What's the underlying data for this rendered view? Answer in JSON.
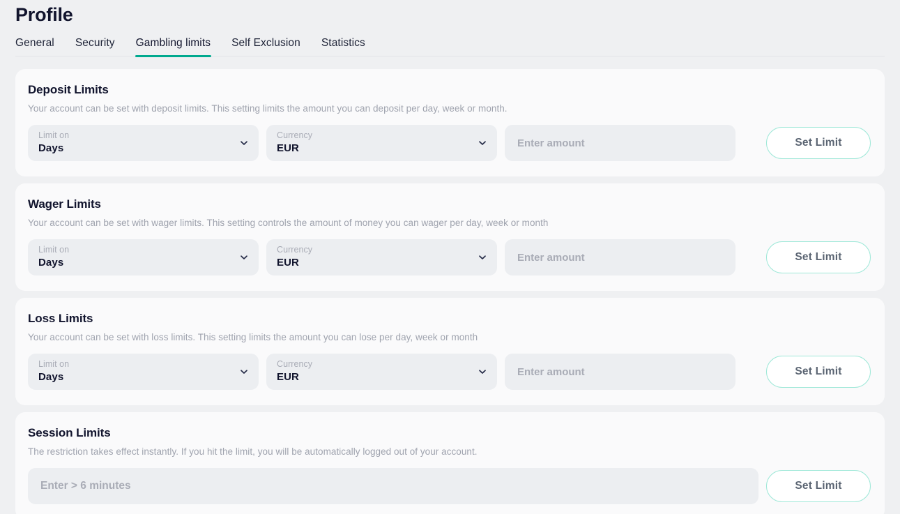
{
  "header": {
    "title": "Profile"
  },
  "tabs": {
    "active": "Gambling limits",
    "items": [
      {
        "label": "General",
        "active": false
      },
      {
        "label": "Security",
        "active": false
      },
      {
        "label": "Gambling limits",
        "active": true
      },
      {
        "label": "Self Exclusion",
        "active": false
      },
      {
        "label": "Statistics",
        "active": false
      }
    ]
  },
  "colors": {
    "page_background": "#eff0f2",
    "card_background": "#fafafb",
    "field_background": "#eceef1",
    "accent_teal": "#00a98f",
    "button_border": "#9fe8d8",
    "title_text": "#11142d",
    "muted_text": "#9fa3ae"
  },
  "cards": [
    {
      "id": "deposit-limits",
      "title": "Deposit Limits",
      "description": "Your account can be set with deposit limits. This setting limits the amount you can deposit per day, week or month.",
      "limit_on": {
        "label": "Limit on",
        "value": "Days"
      },
      "currency": {
        "label": "Currency",
        "value": "EUR"
      },
      "amount": {
        "placeholder": "Enter amount",
        "value": ""
      },
      "submit_label": "Set Limit"
    },
    {
      "id": "wager-limits",
      "title": "Wager Limits",
      "description": "Your account can be set with wager limits. This setting controls the amount of money you can wager per day, week or month",
      "limit_on": {
        "label": "Limit on",
        "value": "Days"
      },
      "currency": {
        "label": "Currency",
        "value": "EUR"
      },
      "amount": {
        "placeholder": "Enter amount",
        "value": ""
      },
      "submit_label": "Set Limit"
    },
    {
      "id": "loss-limits",
      "title": "Loss Limits",
      "description": "Your account can be set with loss limits. This setting limits the amount you can lose per day, week or month",
      "limit_on": {
        "label": "Limit on",
        "value": "Days"
      },
      "currency": {
        "label": "Currency",
        "value": "EUR"
      },
      "amount": {
        "placeholder": "Enter amount",
        "value": ""
      },
      "submit_label": "Set Limit"
    }
  ],
  "session_card": {
    "id": "session-limits",
    "title": "Session Limits",
    "description": "The restriction takes effect instantly. If you hit the limit, you will be automatically logged out of your account.",
    "duration": {
      "placeholder": "Enter > 6 minutes",
      "value": ""
    },
    "submit_label": "Set Limit"
  },
  "icons": {
    "chevron_down": "chevron-down-icon"
  }
}
